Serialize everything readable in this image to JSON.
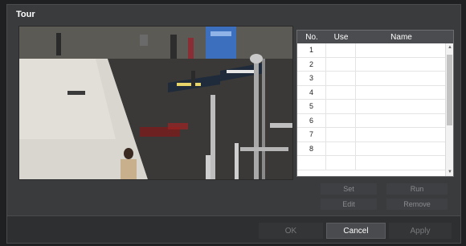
{
  "dialog": {
    "title": "Tour"
  },
  "table": {
    "headers": {
      "no": "No.",
      "use": "Use",
      "name": "Name"
    },
    "rows": [
      {
        "no": "1",
        "use": "",
        "name": ""
      },
      {
        "no": "2",
        "use": "",
        "name": ""
      },
      {
        "no": "3",
        "use": "",
        "name": ""
      },
      {
        "no": "4",
        "use": "",
        "name": ""
      },
      {
        "no": "5",
        "use": "",
        "name": ""
      },
      {
        "no": "6",
        "use": "",
        "name": ""
      },
      {
        "no": "7",
        "use": "",
        "name": ""
      },
      {
        "no": "8",
        "use": "",
        "name": ""
      },
      {
        "no": "",
        "use": "",
        "name": ""
      }
    ]
  },
  "actions": {
    "set": "Set",
    "run": "Run",
    "edit": "Edit",
    "remove": "Remove"
  },
  "footer": {
    "ok": "OK",
    "cancel": "Cancel",
    "apply": "Apply"
  },
  "colors": {
    "dialog_bg": "#3a3b3d",
    "header_bg": "#4b4c50",
    "cancel_bg": "#4a4b4e"
  }
}
